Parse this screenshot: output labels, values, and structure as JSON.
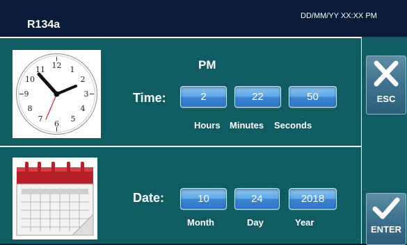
{
  "header": {
    "title": "R134a",
    "datetime": "DD/MM/YY XX:XX PM"
  },
  "time": {
    "ampm": "PM",
    "label": "Time:",
    "hours": "2",
    "minutes": "22",
    "seconds": "50",
    "hours_label": "Hours",
    "minutes_label": "Minutes",
    "seconds_label": "Seconds",
    "icon": "clock-icon"
  },
  "date": {
    "label": "Date:",
    "month": "10",
    "day": "24",
    "year": "2018",
    "month_label": "Month",
    "day_label": "Day",
    "year_label": "Year",
    "icon": "calendar-icon"
  },
  "sidebar": {
    "esc_label": "ESC",
    "enter_label": "ENTER"
  },
  "colors": {
    "background": "#0f5d63",
    "header": "#0b1b3a",
    "field_blue": "#3d86d3"
  }
}
